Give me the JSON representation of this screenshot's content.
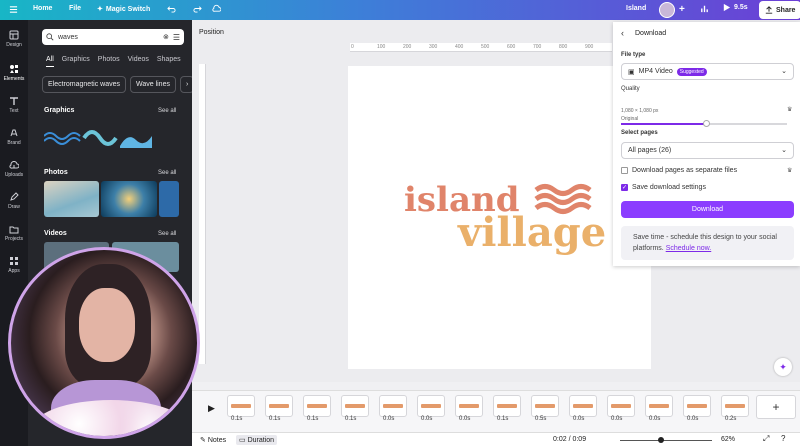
{
  "topbar": {
    "home": "Home",
    "file": "File",
    "magic_switch": "Magic Switch",
    "title": "Island",
    "play_time": "9.5s",
    "share": "Share"
  },
  "rail": {
    "items": [
      {
        "label": "Design",
        "icon": "layout-icon"
      },
      {
        "label": "Elements",
        "icon": "shapes-icon"
      },
      {
        "label": "Text",
        "icon": "text-icon"
      },
      {
        "label": "Brand",
        "icon": "brand-icon"
      },
      {
        "label": "Uploads",
        "icon": "upload-icon"
      },
      {
        "label": "Draw",
        "icon": "pen-icon"
      },
      {
        "label": "Projects",
        "icon": "folder-icon"
      },
      {
        "label": "Apps",
        "icon": "apps-icon"
      }
    ]
  },
  "panel": {
    "search_value": "waves",
    "tabs": [
      "All",
      "Graphics",
      "Photos",
      "Videos",
      "Shapes"
    ],
    "chips": [
      "Electromagnetic waves",
      "Wave lines"
    ],
    "sections": {
      "graphics": "Graphics",
      "photos": "Photos",
      "videos": "Videos",
      "see_all": "See all"
    }
  },
  "canvas": {
    "position_label": "Position",
    "ruler_h": [
      "0",
      "100",
      "200",
      "300",
      "400",
      "500",
      "600",
      "700",
      "800",
      "900",
      "1000"
    ],
    "logo_line1": "island",
    "logo_line2": "village",
    "colors": {
      "island": "#e0846a",
      "village": "#eab06a",
      "waves": "#e0846a"
    }
  },
  "download": {
    "title": "Download",
    "file_type_label": "File type",
    "file_type_value": "MP4 Video",
    "suggested_badge": "Suggested",
    "quality_label": "Quality",
    "quality_note_1": "1,080 × 1,080 px",
    "quality_note_2": "Original",
    "select_pages_label": "Select pages",
    "pages_value": "All pages (26)",
    "separate_files": "Download pages as separate files",
    "save_settings": "Save download settings",
    "button": "Download",
    "promo_text": "Save time - schedule this design to your social platforms.",
    "promo_link": "Schedule now."
  },
  "timeline": {
    "durations": [
      "0.1s",
      "0.1s",
      "0.1s",
      "0.1s",
      "0.0s",
      "0.0s",
      "0.0s",
      "0.1s",
      "0.5s",
      "0.0s",
      "0.0s",
      "0.0s",
      "0.0s",
      "0.0s",
      "0.2s"
    ]
  },
  "bottombar": {
    "notes": "Notes",
    "duration": "Duration",
    "time": "0:02 / 0:09",
    "zoom": "62%"
  },
  "accent_color": "#8b3dff"
}
